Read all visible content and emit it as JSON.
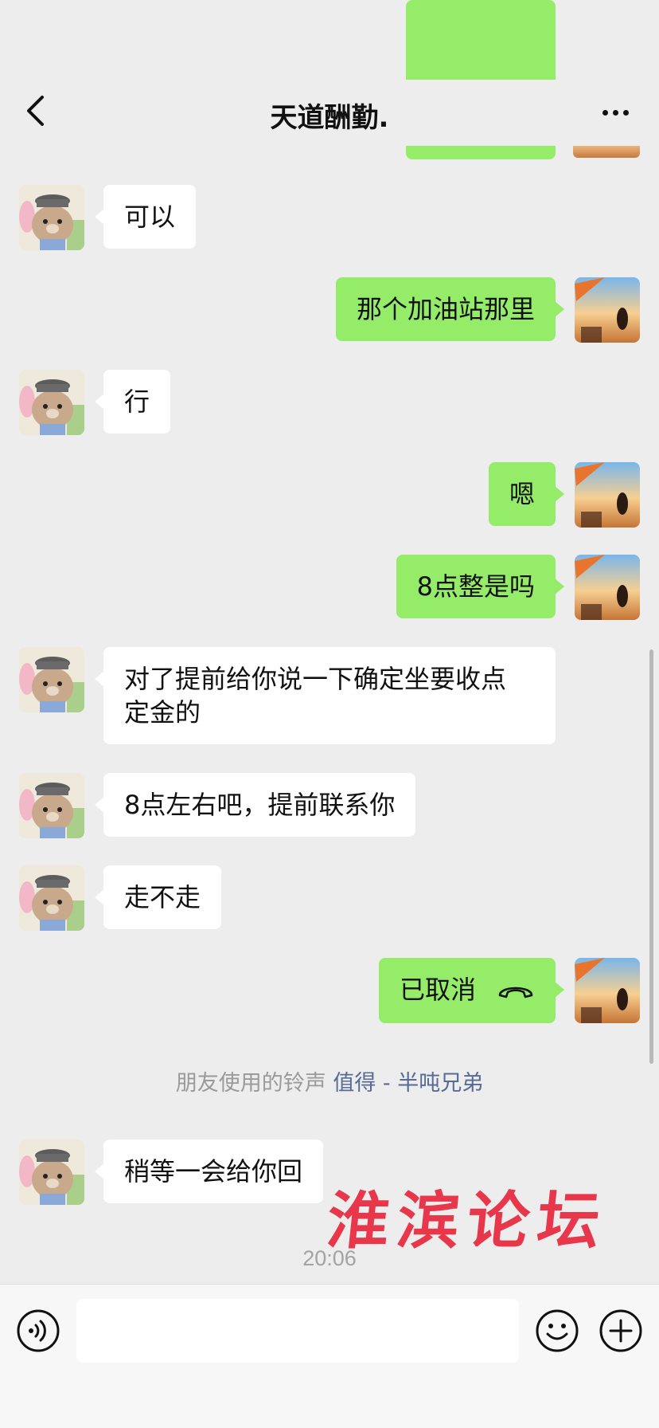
{
  "header": {
    "title": "天道酬勤.",
    "back_icon": "chevron-left-icon",
    "more_icon": "more-dots-icon"
  },
  "messages": [
    {
      "side": "left",
      "text": "可以"
    },
    {
      "side": "right",
      "text": "那个加油站那里"
    },
    {
      "side": "left",
      "text": "行"
    },
    {
      "side": "right",
      "text": "嗯"
    },
    {
      "side": "right",
      "text": "8点整是吗"
    },
    {
      "side": "left",
      "text": "对了提前给你说一下确定坐要收点\n定金的"
    },
    {
      "side": "left",
      "text": "8点左右吧，提前联系你"
    },
    {
      "side": "left",
      "text": "走不走"
    },
    {
      "side": "right",
      "text": "已取消",
      "icon": "phone-hangup-icon"
    },
    {
      "side": "left",
      "text": "稍等一会给你回"
    }
  ],
  "system_notice": {
    "prefix": "朋友使用的铃声",
    "link": "值得 - 半吨兄弟"
  },
  "timestamp": "20:06",
  "watermark": "淮滨论坛",
  "input_bar": {
    "voice_icon": "voice-icon",
    "emoji_icon": "emoji-icon",
    "plus_icon": "plus-icon",
    "placeholder": ""
  },
  "colors": {
    "background": "#ededed",
    "sent_bubble": "#95ec69",
    "received_bubble": "#ffffff",
    "link": "#576b95",
    "watermark": "#e8283e"
  }
}
